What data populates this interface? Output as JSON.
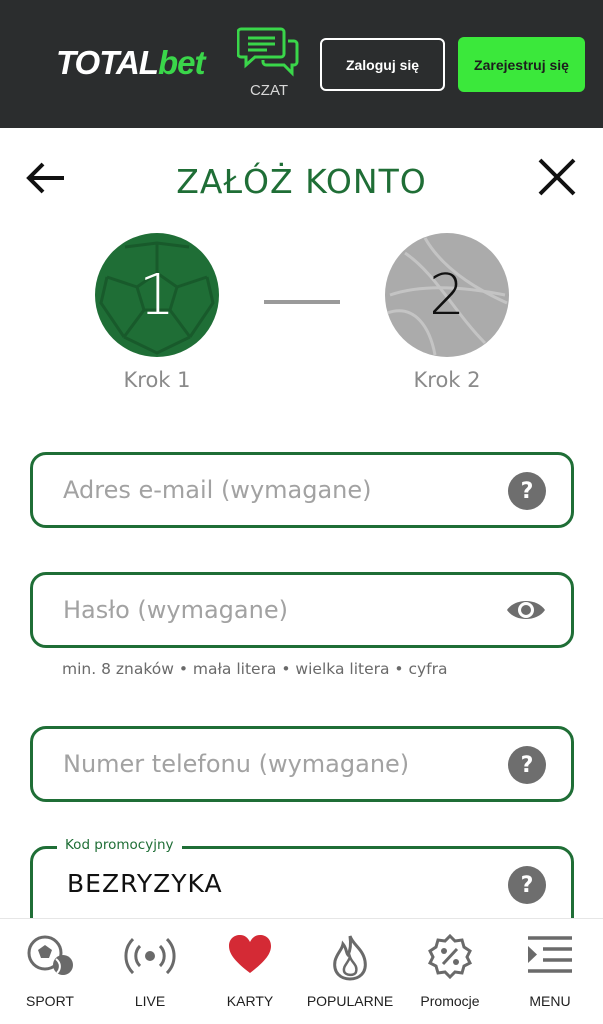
{
  "header": {
    "logo_total": "TOTAL",
    "logo_bet": "bet",
    "chat_label": "CZAT",
    "login_label": "Zaloguj się",
    "register_label": "Zarejestruj się",
    "colors": {
      "background": "#2b2d2e",
      "accent": "#3be83b"
    }
  },
  "page": {
    "title": "ZAŁÓŻ KONTO",
    "back_icon": "arrow-left-icon",
    "close_icon": "close-icon"
  },
  "steps": {
    "items": [
      {
        "number": "1",
        "label": "Krok 1",
        "state": "active",
        "color": "#1f6e36",
        "icon": "football-icon"
      },
      {
        "number": "2",
        "label": "Krok 2",
        "state": "inactive",
        "color": "#ababab",
        "icon": "basketball-icon"
      }
    ]
  },
  "form": {
    "email": {
      "placeholder": "Adres e-mail (wymagane)",
      "value": "",
      "icon": "help-icon"
    },
    "password": {
      "placeholder": "Hasło (wymagane)",
      "value": "",
      "icon": "eye-icon"
    },
    "password_hint": "min. 8 znaków • mała litera • wielka litera • cyfra",
    "phone": {
      "placeholder": "Numer telefonu (wymagane)",
      "value": "",
      "icon": "help-icon"
    },
    "promo": {
      "label": "Kod promocyjny",
      "value": "BEZRYZYKA",
      "icon": "help-icon"
    },
    "help_glyph": "?",
    "border_color": "#1f6e36"
  },
  "bottom_nav": {
    "items": [
      {
        "label": "SPORT",
        "icon": "sport-balls-icon"
      },
      {
        "label": "LIVE",
        "icon": "live-broadcast-icon"
      },
      {
        "label": "KARTY",
        "icon": "heart-icon"
      },
      {
        "label": "POPULARNE",
        "icon": "flame-icon"
      },
      {
        "label": "Promocje",
        "icon": "percent-badge-icon"
      },
      {
        "label": "MENU",
        "icon": "menu-icon"
      }
    ]
  }
}
